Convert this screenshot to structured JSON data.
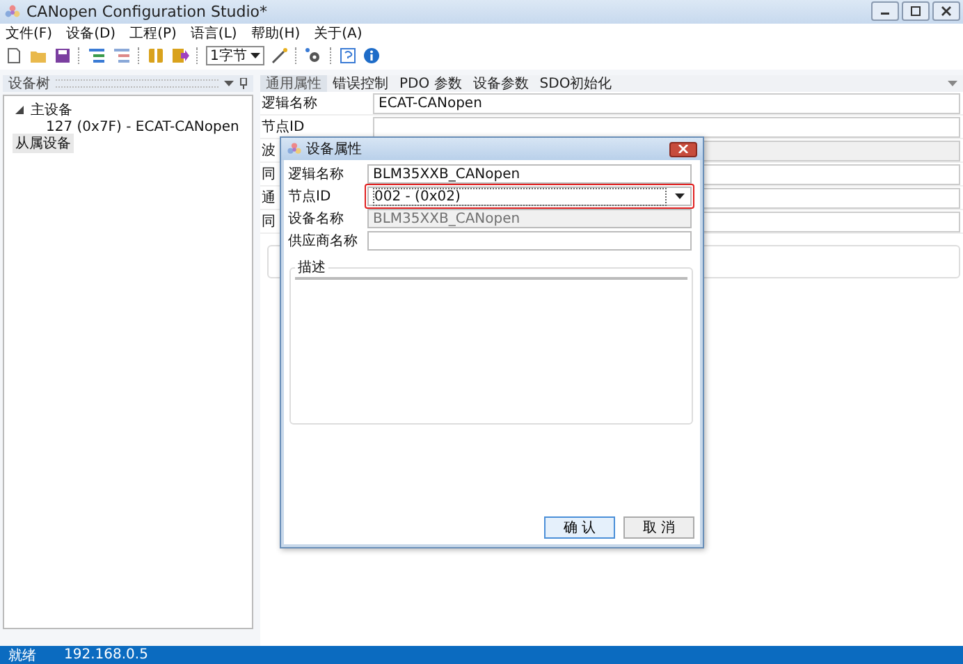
{
  "window": {
    "title": "CANopen Configuration Studio*"
  },
  "menu": [
    "文件(F)",
    "设备(D)",
    "工程(P)",
    "语言(L)",
    "帮助(H)",
    "关于(A)"
  ],
  "toolbar": {
    "unit_select": "1字节"
  },
  "device_tree": {
    "title": "设备树",
    "items": [
      {
        "label": "主设备",
        "expanded": true,
        "selected": false,
        "children": [
          {
            "label": "127 (0x7F)  -  ECAT-CANopen",
            "selected": false
          }
        ]
      },
      {
        "label": "从属设备",
        "selected": true
      }
    ]
  },
  "tabs": [
    {
      "label": "通用属性",
      "selected": true
    },
    {
      "label": "错误控制",
      "selected": false
    },
    {
      "label": "PDO 参数",
      "selected": false
    },
    {
      "label": "设备参数",
      "selected": false
    },
    {
      "label": "SDO初始化",
      "selected": false
    }
  ],
  "properties": [
    {
      "label": "逻辑名称",
      "value": "ECAT-CANopen",
      "kind": "text"
    },
    {
      "label": "节点ID",
      "kind": "text"
    },
    {
      "label": "波",
      "kind": "dropdown"
    },
    {
      "label": "同",
      "kind": "text"
    },
    {
      "label": "通",
      "kind": "text"
    },
    {
      "label": "同",
      "kind": "text"
    }
  ],
  "dialog": {
    "title": "设备属性",
    "fields": [
      {
        "label": "逻辑名称",
        "value": "BLM35XXB_CANopen",
        "kind": "text",
        "disabled": false,
        "highlighted": false
      },
      {
        "label": "节点ID",
        "value": "002 - (0x02)",
        "kind": "dropdown",
        "disabled": false,
        "highlighted": true
      },
      {
        "label": "设备名称",
        "value": "BLM35XXB_CANopen",
        "kind": "text",
        "disabled": true,
        "highlighted": false
      },
      {
        "label": "供应商名称",
        "kind": "text",
        "disabled": false,
        "highlighted": false
      }
    ],
    "description": {
      "label": "描述"
    },
    "buttons": [
      "确 认",
      "取 消"
    ]
  },
  "status_bar": {
    "status": "就绪",
    "address": "192.168.0.5"
  }
}
